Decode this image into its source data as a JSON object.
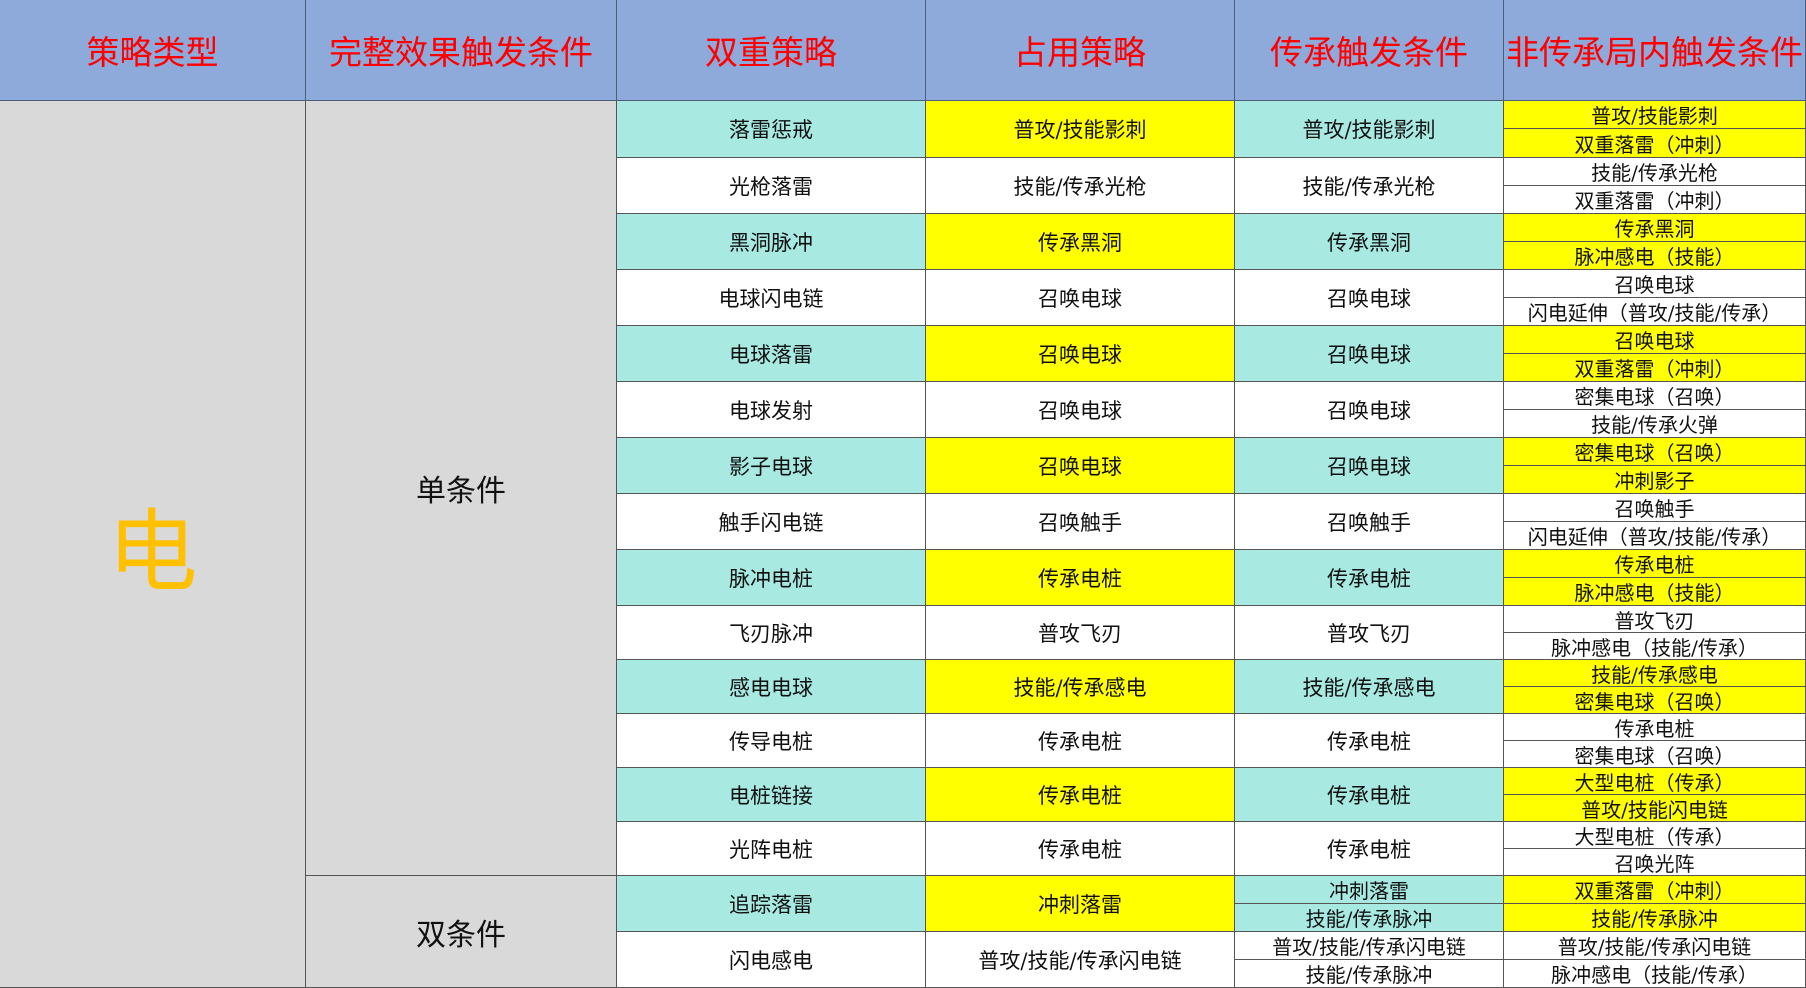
{
  "headers": [
    "策略类型",
    "完整效果触发条件",
    "双重策略",
    "占用策略",
    "传承触发条件",
    "非传承局内触发条件"
  ],
  "category": "电",
  "groups": [
    {
      "label": "单条件"
    },
    {
      "label": "双条件"
    }
  ],
  "colors": {
    "header_bg": "#8eaadb",
    "header_text": "#ff0000",
    "teal": "#a8eae2",
    "yellow": "#ffff00",
    "white": "#ffffff",
    "grey": "#d9d9d9",
    "category_text": "#ffc000"
  },
  "rows": [
    {
      "name": "落雷惩戒",
      "occupy": "普攻/技能影刺",
      "inherit": [
        "普攻/技能影刺"
      ],
      "non_inherit": [
        "普攻/技能影刺",
        "双重落雷（冲刺）"
      ],
      "highlight": true
    },
    {
      "name": "光枪落雷",
      "occupy": "技能/传承光枪",
      "inherit": [
        "技能/传承光枪"
      ],
      "non_inherit": [
        "技能/传承光枪",
        "双重落雷（冲刺）"
      ],
      "highlight": false
    },
    {
      "name": "黑洞脉冲",
      "occupy": "传承黑洞",
      "inherit": [
        "传承黑洞"
      ],
      "non_inherit": [
        "传承黑洞",
        "脉冲感电（技能）"
      ],
      "highlight": true
    },
    {
      "name": "电球闪电链",
      "occupy": "召唤电球",
      "inherit": [
        "召唤电球"
      ],
      "non_inherit": [
        "召唤电球",
        "闪电延伸（普攻/技能/传承）"
      ],
      "highlight": false
    },
    {
      "name": "电球落雷",
      "occupy": "召唤电球",
      "inherit": [
        "召唤电球"
      ],
      "non_inherit": [
        "召唤电球",
        "双重落雷（冲刺）"
      ],
      "highlight": true
    },
    {
      "name": "电球发射",
      "occupy": "召唤电球",
      "inherit": [
        "召唤电球"
      ],
      "non_inherit": [
        "密集电球（召唤）",
        "技能/传承火弹"
      ],
      "highlight": false
    },
    {
      "name": "影子电球",
      "occupy": "召唤电球",
      "inherit": [
        "召唤电球"
      ],
      "non_inherit": [
        "密集电球（召唤）",
        "冲刺影子"
      ],
      "highlight": true
    },
    {
      "name": "触手闪电链",
      "occupy": "召唤触手",
      "inherit": [
        "召唤触手"
      ],
      "non_inherit": [
        "召唤触手",
        "闪电延伸（普攻/技能/传承）"
      ],
      "highlight": false
    },
    {
      "name": "脉冲电桩",
      "occupy": "传承电桩",
      "inherit": [
        "传承电桩"
      ],
      "non_inherit": [
        "传承电桩",
        "脉冲感电（技能）"
      ],
      "highlight": true
    },
    {
      "name": "飞刃脉冲",
      "occupy": "普攻飞刃",
      "inherit": [
        "普攻飞刃"
      ],
      "non_inherit": [
        "普攻飞刃",
        "脉冲感电（技能/传承）"
      ],
      "highlight": false
    },
    {
      "name": "感电电球",
      "occupy": "技能/传承感电",
      "inherit": [
        "技能/传承感电"
      ],
      "non_inherit": [
        "技能/传承感电",
        "密集电球（召唤）"
      ],
      "highlight": true
    },
    {
      "name": "传导电桩",
      "occupy": "传承电桩",
      "inherit": [
        "传承电桩"
      ],
      "non_inherit": [
        "传承电桩",
        "密集电球（召唤）"
      ],
      "highlight": false
    },
    {
      "name": "电桩链接",
      "occupy": "传承电桩",
      "inherit": [
        "传承电桩"
      ],
      "non_inherit": [
        "大型电桩（传承）",
        "普攻/技能闪电链"
      ],
      "highlight": true
    },
    {
      "name": "光阵电桩",
      "occupy": "传承电桩",
      "inherit": [
        "传承电桩"
      ],
      "non_inherit": [
        "大型电桩（传承）",
        "召唤光阵"
      ],
      "highlight": false
    },
    {
      "name": "追踪落雷",
      "occupy": "冲刺落雷",
      "inherit": [
        "冲刺落雷",
        "技能/传承脉冲"
      ],
      "non_inherit": [
        "双重落雷（冲刺）",
        "技能/传承脉冲"
      ],
      "highlight": true
    },
    {
      "name": "闪电感电",
      "occupy": "普攻/技能/传承闪电链",
      "inherit": [
        "普攻/技能/传承闪电链",
        "技能/传承脉冲"
      ],
      "non_inherit": [
        "普攻/技能/传承闪电链",
        "脉冲感电（技能/传承）"
      ],
      "highlight": false
    }
  ]
}
